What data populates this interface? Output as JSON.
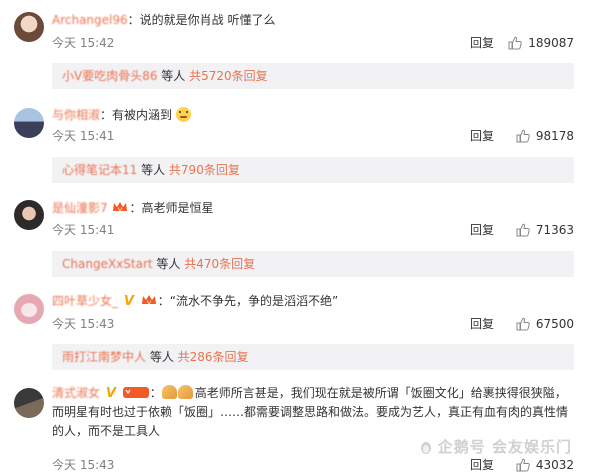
{
  "comments": [
    {
      "username": "Archangel96",
      "text": "说的就是你肖战 听懂了么",
      "time": "今天 15:42",
      "reply_label": "回复",
      "likes": "189087",
      "sub": {
        "user": "小V要吃肉骨头86",
        "mid": " 等人 ",
        "count": "共5720条回复"
      }
    },
    {
      "username": "与你相淑",
      "text": "有被内涵到",
      "time": "今天 15:41",
      "reply_label": "回复",
      "likes": "98178",
      "sub": {
        "user": "心得笔记本11",
        "mid": " 等人 ",
        "count": "共790条回复"
      }
    },
    {
      "username": "是仙潼影7",
      "text": "高老师是恒星",
      "time": "今天 15:41",
      "reply_label": "回复",
      "likes": "71363",
      "sub": {
        "user": "ChangeXxStart",
        "mid": " 等人 ",
        "count": "共470条回复"
      }
    },
    {
      "username": "四叶草少女_",
      "text": "“流水不争先，争的是滔滔不绝”",
      "time": "今天 15:43",
      "reply_label": "回复",
      "likes": "67500",
      "sub": {
        "user": "雨打江南梦中人",
        "mid": " 等人 ",
        "count": "共286条回复"
      }
    },
    {
      "username": "清式淑女",
      "text": "高老师所言甚是，我们现在就是被所谓「饭圈文化」给裹挟得很狭隘，而明星有时也过于依赖「饭圈」……都需要调整思路和做法。要成为艺人，真正有血有肉的真性情的人，而不是工具人",
      "time": "今天 15:43",
      "reply_label": "回复",
      "likes": "43032"
    }
  ],
  "watermark": "企鹅号 会友娱乐门",
  "colors": {
    "username": "#eb7350",
    "meta": "#808080",
    "subbox_bg": "#f2f2f5",
    "vbadge": "#f7a400"
  }
}
